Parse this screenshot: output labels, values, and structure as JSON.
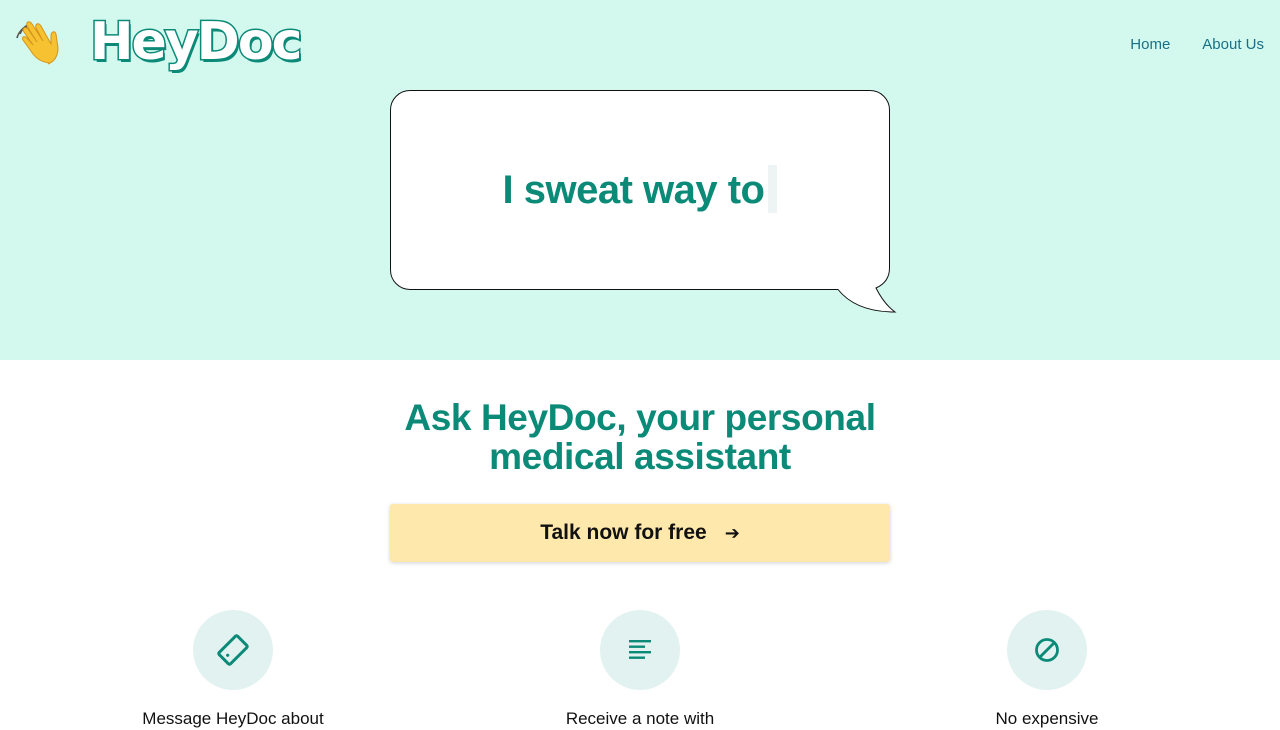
{
  "header": {
    "logo_text": "HeyDoc",
    "logo_icon": "waving-hand-icon",
    "nav": [
      {
        "label": "Home"
      },
      {
        "label": "About Us"
      }
    ]
  },
  "hero": {
    "bubble_text": "I sweat way to"
  },
  "main": {
    "headline_line1": "Ask HeyDoc, your personal",
    "headline_line2": "medical assistant",
    "cta_label": "Talk now for free",
    "cta_arrow": "➔"
  },
  "features": [
    {
      "icon": "phone-message-icon",
      "text": "Message HeyDoc about"
    },
    {
      "icon": "notes-lines-icon",
      "text": "Receive a note with"
    },
    {
      "icon": "no-symbol-icon",
      "text": "No expensive"
    }
  ],
  "colors": {
    "hero_bg": "#d3f9ee",
    "brand": "#0b8a78",
    "nav_link": "#1a6f86",
    "cta_bg": "#fee8ab",
    "icon_circle": "#e2f2f0"
  }
}
